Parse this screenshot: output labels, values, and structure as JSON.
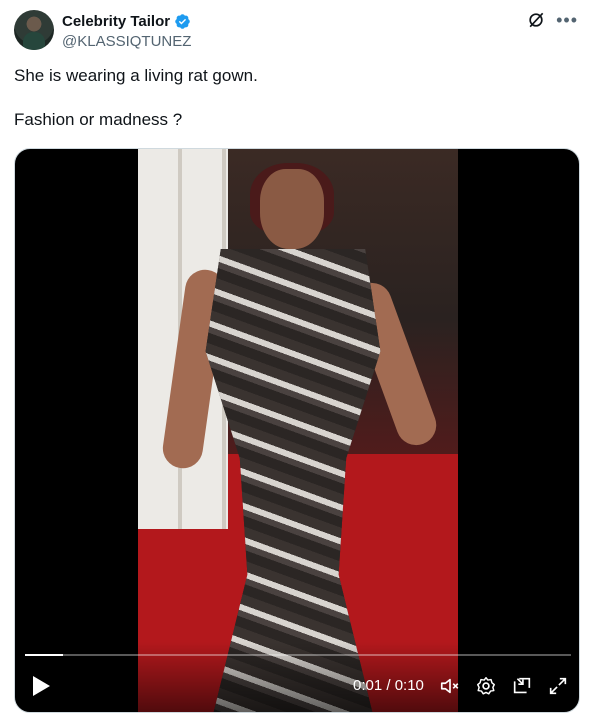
{
  "author": {
    "display_name": "Celebrity Tailor",
    "handle": "@KLASSIQTUNEZ",
    "verified": true
  },
  "icons": {
    "verified": "verified-badge-icon",
    "grok": "grok-icon",
    "more": "more-icon",
    "play": "play-icon",
    "volume": "volume-muted-icon",
    "settings": "settings-icon",
    "pip": "picture-in-picture-icon",
    "fullscreen": "fullscreen-icon"
  },
  "tweet": {
    "line1": "She is wearing a living rat gown.",
    "line2": "Fashion or madness ?"
  },
  "video": {
    "current_time": "0:01",
    "duration": "0:10",
    "time_display": "0:01 / 0:10",
    "progress_fraction": 0.07
  },
  "colors": {
    "accent": "#1d9bf0",
    "text": "#0f1419",
    "secondary": "#536471"
  }
}
